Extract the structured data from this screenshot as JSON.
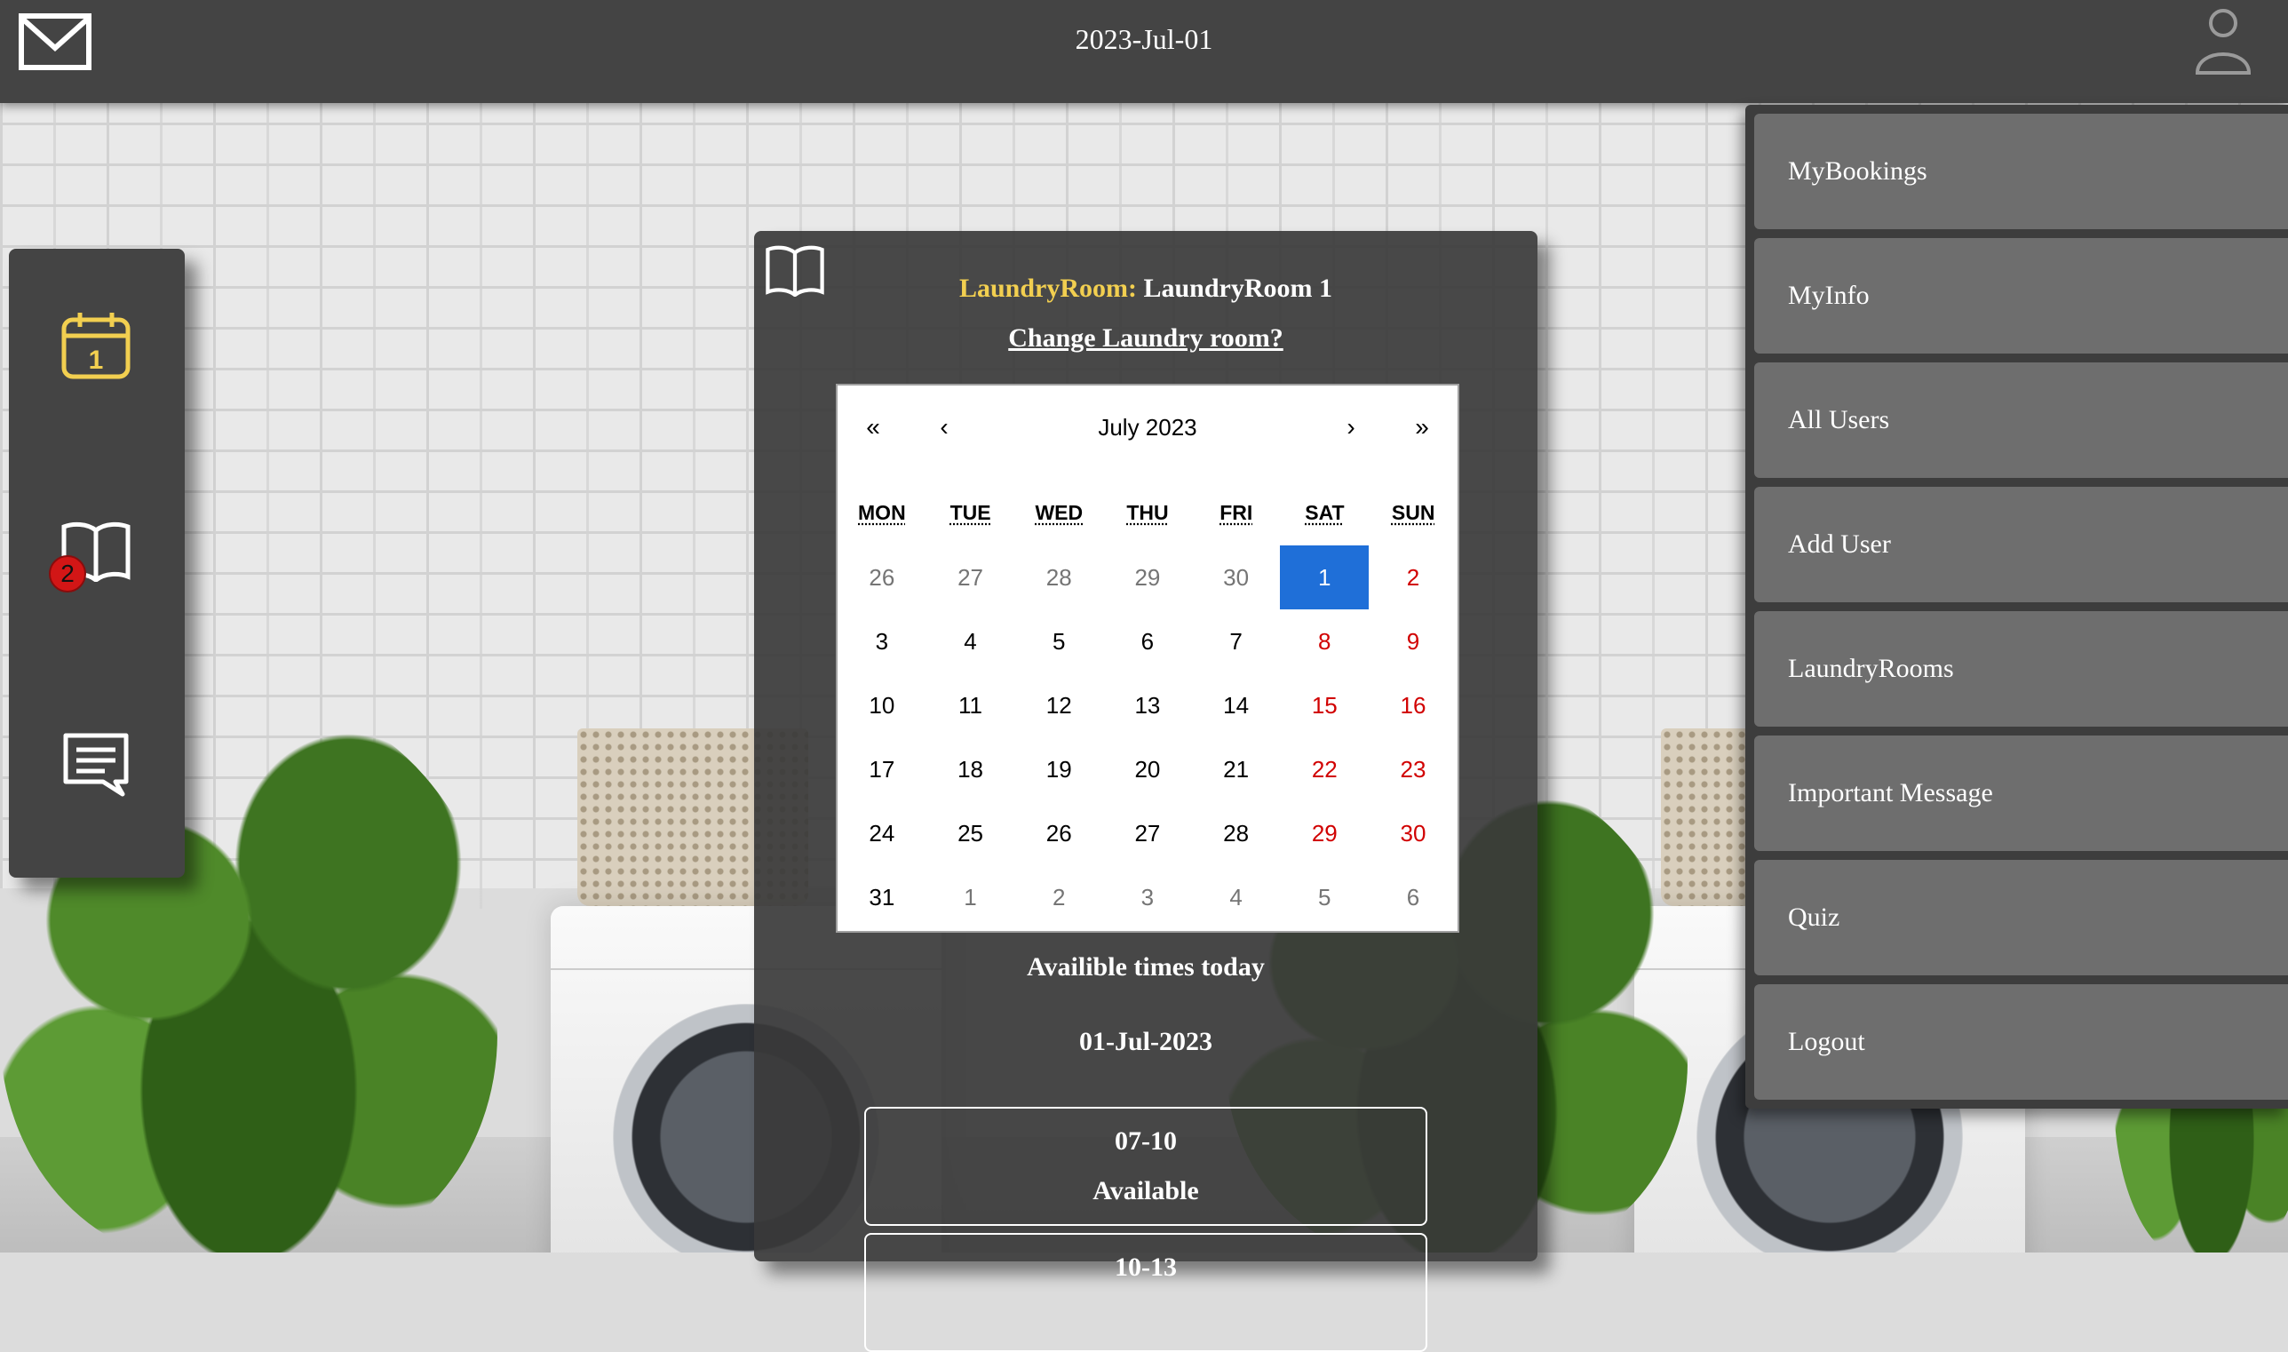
{
  "header": {
    "date": "2023-Jul-01",
    "mail_icon": "mail-icon",
    "user_icon": "user-profile-icon"
  },
  "sidebar": {
    "items": [
      {
        "icon": "calendar-icon",
        "icon_text": "1"
      },
      {
        "icon": "book-icon",
        "badge": "2"
      },
      {
        "icon": "message-icon"
      }
    ],
    "accent": "#f2cf50"
  },
  "main": {
    "room_label": "LaundryRoom:",
    "room_name": "LaundryRoom 1",
    "change_room": "Change Laundry room?",
    "calendar": {
      "nav": {
        "prev_year": "«",
        "prev_month": "‹",
        "next_month": "›",
        "next_year": "»"
      },
      "month_label": "July 2023",
      "weekdays": [
        "MON",
        "TUE",
        "WED",
        "THU",
        "FRI",
        "SAT",
        "SUN"
      ],
      "selected_color": "#1f6fd8",
      "weekend_color": "#d10000",
      "days": [
        {
          "label": "26",
          "neighbor": true
        },
        {
          "label": "27",
          "neighbor": true
        },
        {
          "label": "28",
          "neighbor": true
        },
        {
          "label": "29",
          "neighbor": true
        },
        {
          "label": "30",
          "neighbor": true
        },
        {
          "label": "1",
          "active": true
        },
        {
          "label": "2",
          "weekend": true
        },
        {
          "label": "3"
        },
        {
          "label": "4"
        },
        {
          "label": "5"
        },
        {
          "label": "6"
        },
        {
          "label": "7"
        },
        {
          "label": "8",
          "weekend": true
        },
        {
          "label": "9",
          "weekend": true
        },
        {
          "label": "10"
        },
        {
          "label": "11"
        },
        {
          "label": "12"
        },
        {
          "label": "13"
        },
        {
          "label": "14"
        },
        {
          "label": "15",
          "weekend": true
        },
        {
          "label": "16",
          "weekend": true
        },
        {
          "label": "17"
        },
        {
          "label": "18"
        },
        {
          "label": "19"
        },
        {
          "label": "20"
        },
        {
          "label": "21"
        },
        {
          "label": "22",
          "weekend": true
        },
        {
          "label": "23",
          "weekend": true
        },
        {
          "label": "24"
        },
        {
          "label": "25"
        },
        {
          "label": "26"
        },
        {
          "label": "27"
        },
        {
          "label": "28"
        },
        {
          "label": "29",
          "weekend": true
        },
        {
          "label": "30",
          "weekend": true
        },
        {
          "label": "31"
        },
        {
          "label": "1",
          "neighbor": true
        },
        {
          "label": "2",
          "neighbor": true
        },
        {
          "label": "3",
          "neighbor": true
        },
        {
          "label": "4",
          "neighbor": true
        },
        {
          "label": "5",
          "neighbor": true
        },
        {
          "label": "6",
          "neighbor": true
        }
      ]
    },
    "available_title": "Availible times today",
    "available_date": "01-Jul-2023",
    "slots": [
      {
        "time": "07-10",
        "status": "Available"
      },
      {
        "time": "10-13",
        "status": ""
      }
    ],
    "book_icon": "book-icon"
  },
  "menu": {
    "items": [
      "MyBookings",
      "MyInfo",
      "All Users",
      "Add User",
      "LaundryRooms",
      "Important Message",
      "Quiz",
      "Logout"
    ]
  }
}
